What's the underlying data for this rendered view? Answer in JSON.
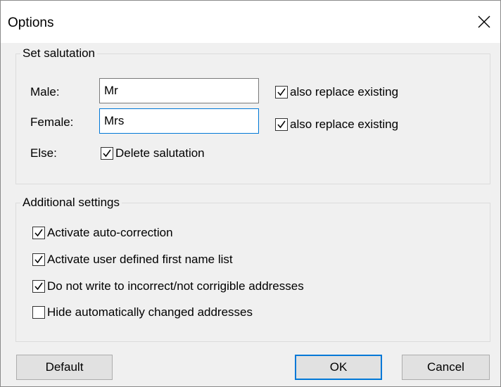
{
  "window": {
    "title": "Options"
  },
  "salutation": {
    "legend": "Set salutation",
    "male_label": "Male:",
    "male_value": "Mr",
    "female_label": "Female:",
    "female_value": "Mrs",
    "else_label": "Else:",
    "male_replace_label": "also replace existing",
    "male_replace_checked": true,
    "female_replace_label": "also replace existing",
    "female_replace_checked": true,
    "delete_label": "Delete salutation",
    "delete_checked": true
  },
  "additional": {
    "legend": "Additional settings",
    "options": [
      {
        "label": "Activate auto-correction",
        "checked": true
      },
      {
        "label": "Activate user defined first name list",
        "checked": true
      },
      {
        "label": "Do not write to incorrect/not corrigible addresses",
        "checked": true
      },
      {
        "label": "Hide automatically changed addresses",
        "checked": false
      }
    ]
  },
  "buttons": {
    "default_label": "Default",
    "ok_label": "OK",
    "cancel_label": "Cancel"
  },
  "colors": {
    "accent": "#0078d7",
    "dialog_bg": "#f0f0f0",
    "button_bg": "#e1e1e1"
  },
  "icons": {
    "close": "close-icon",
    "check": "checkmark-icon"
  }
}
